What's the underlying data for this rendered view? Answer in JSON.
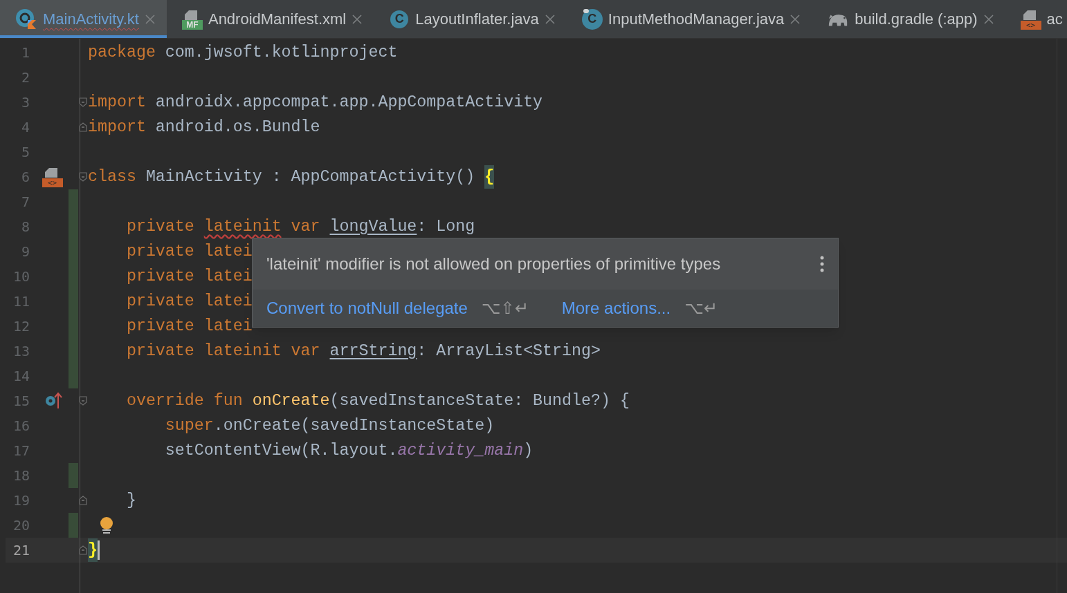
{
  "tabs": [
    {
      "label": "MainActivity.kt",
      "kind": "kotlin",
      "selected": true,
      "error": true
    },
    {
      "label": "AndroidManifest.xml",
      "kind": "manifest",
      "badge": "MF",
      "selected": false,
      "error": false
    },
    {
      "label": "LayoutInflater.java",
      "kind": "class",
      "badge": "C",
      "selected": false,
      "error": false
    },
    {
      "label": "InputMethodManager.java",
      "kind": "library",
      "badge": "C",
      "selected": false,
      "error": false
    },
    {
      "label": "build.gradle (:app)",
      "kind": "gradle",
      "selected": false,
      "error": false
    },
    {
      "label": "ac",
      "kind": "layout",
      "badge": "<>",
      "selected": false,
      "error": false
    }
  ],
  "lines": [
    {
      "number": "1",
      "kind": "plain",
      "current": false,
      "changed": false,
      "tokens": [
        {
          "text": "package",
          "kind": "keyword"
        },
        {
          "text": " com.jwsoft.kotlinproject",
          "kind": "plain"
        }
      ]
    },
    {
      "number": "2",
      "kind": "plain",
      "current": false,
      "changed": false
    },
    {
      "number": "3",
      "kind": "foldstart",
      "current": false,
      "changed": false,
      "tokens": [
        {
          "text": "import",
          "kind": "keyword"
        },
        {
          "text": " androidx.appcompat.app.AppCompatActivity",
          "kind": "plain"
        }
      ]
    },
    {
      "number": "4",
      "kind": "foldend",
      "current": false,
      "changed": false,
      "tokens": [
        {
          "text": "import",
          "kind": "keyword"
        },
        {
          "text": " android.os.Bundle",
          "kind": "plain"
        }
      ]
    },
    {
      "number": "5",
      "kind": "plain",
      "current": false,
      "changed": false
    },
    {
      "number": "6",
      "kind": "layoutclass",
      "gutter_badge": "<>",
      "current": false,
      "changed": false,
      "tokens": [
        {
          "text": "class",
          "kind": "keyword"
        },
        {
          "text": " MainActivity : AppCompatActivity() ",
          "kind": "plain"
        },
        {
          "text": "{",
          "kind": "brace_match"
        }
      ]
    },
    {
      "number": "7",
      "kind": "plain",
      "current": false,
      "changed": true
    },
    {
      "number": "8",
      "kind": "plain",
      "current": false,
      "changed": true,
      "tokens": [
        {
          "text": "    private ",
          "kind": "keyword"
        },
        {
          "text": "lateinit",
          "kind": "keyword_error"
        },
        {
          "text": " var ",
          "kind": "keyword"
        },
        {
          "text": "longValue",
          "kind": "property"
        },
        {
          "text": ": Long",
          "kind": "plain"
        }
      ]
    },
    {
      "number": "9",
      "kind": "plain",
      "current": false,
      "changed": true,
      "tokens": [
        {
          "text": "    private latei",
          "kind": "keyword"
        }
      ]
    },
    {
      "number": "10",
      "kind": "plain",
      "current": false,
      "changed": true,
      "tokens": [
        {
          "text": "    private latei",
          "kind": "keyword"
        }
      ]
    },
    {
      "number": "11",
      "kind": "plain",
      "current": false,
      "changed": true,
      "tokens": [
        {
          "text": "    private latei",
          "kind": "keyword"
        }
      ]
    },
    {
      "number": "12",
      "kind": "plain",
      "current": false,
      "changed": true,
      "tokens": [
        {
          "text": "    private latei",
          "kind": "keyword"
        }
      ]
    },
    {
      "number": "13",
      "kind": "plain",
      "current": false,
      "changed": true,
      "tokens": [
        {
          "text": "    private lateinit var ",
          "kind": "keyword"
        },
        {
          "text": "arrString",
          "kind": "property"
        },
        {
          "text": ": ArrayList<String>",
          "kind": "plain"
        }
      ]
    },
    {
      "number": "14",
      "kind": "plain",
      "current": false,
      "changed": true
    },
    {
      "number": "15",
      "kind": "overridefun",
      "current": false,
      "changed": false,
      "tokens": [
        {
          "text": "    override fun ",
          "kind": "keyword"
        },
        {
          "text": "onCreate",
          "kind": "function"
        },
        {
          "text": "(savedInstanceState: Bundle?) {",
          "kind": "plain"
        }
      ]
    },
    {
      "number": "16",
      "kind": "plain",
      "current": false,
      "changed": false,
      "tokens": [
        {
          "text": "        super",
          "kind": "keyword"
        },
        {
          "text": ".onCreate(savedInstanceState)",
          "kind": "plain"
        }
      ]
    },
    {
      "number": "17",
      "kind": "plain",
      "current": false,
      "changed": false,
      "tokens": [
        {
          "text": "        setContentView(R.layout.",
          "kind": "plain"
        },
        {
          "text": "activity_main",
          "kind": "field"
        },
        {
          "text": ")",
          "kind": "plain"
        }
      ]
    },
    {
      "number": "18",
      "kind": "plain",
      "current": false,
      "changed": true
    },
    {
      "number": "19",
      "kind": "foldend",
      "current": false,
      "changed": false,
      "tokens": [
        {
          "text": "    }",
          "kind": "plain"
        }
      ]
    },
    {
      "number": "20",
      "kind": "bulb",
      "current": false,
      "changed": true
    },
    {
      "number": "21",
      "kind": "foldend",
      "current": true,
      "changed": false,
      "tokens": [
        {
          "text": "}",
          "kind": "brace_match"
        }
      ]
    }
  ],
  "popup": {
    "message": "'lateinit' modifier is not allowed on properties of primitive types",
    "actions": [
      {
        "label": "Convert to notNull delegate",
        "shortcut": "⌥⇧↵"
      },
      {
        "label": "More actions...",
        "shortcut": "⌥↵"
      }
    ]
  }
}
